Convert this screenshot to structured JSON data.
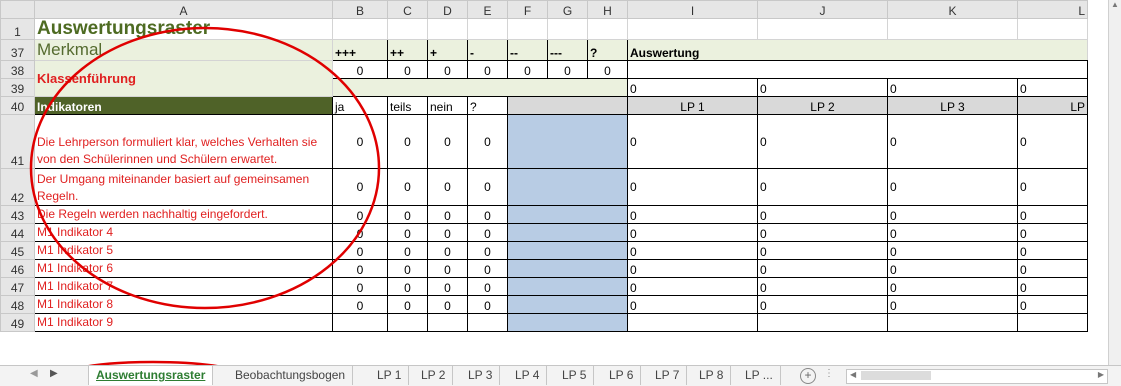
{
  "columns": [
    "A",
    "B",
    "C",
    "D",
    "E",
    "F",
    "G",
    "H",
    "I",
    "J",
    "K",
    "L"
  ],
  "rows": {
    "r1": {
      "num": "1",
      "title": "Auswertungsraster"
    },
    "r37": {
      "num": "37",
      "merkmal": "Merkmal",
      "symbols": [
        "+++",
        "++",
        "+",
        "-",
        "--",
        "---",
        "?"
      ],
      "auswertung": "Auswertung"
    },
    "r38": {
      "num": "38",
      "values": [
        "0",
        "0",
        "0",
        "0",
        "0",
        "0",
        "0"
      ]
    },
    "r38a": {
      "label": "Klassenführung"
    },
    "r39": {
      "num": "39",
      "lp_values": [
        "0",
        "0",
        "0",
        "0"
      ]
    },
    "r40": {
      "num": "40",
      "indikatoren": "Indikatoren",
      "headers": [
        "ja",
        "teils",
        "nein",
        "?"
      ],
      "lp": [
        "LP 1",
        "LP 2",
        "LP 3",
        "LP"
      ]
    },
    "r41": {
      "num": "41",
      "text": "Die Lehrperson formuliert klar, welches Verhalten sie von den Schülerinnen und Schülern erwartet.",
      "values": [
        "0",
        "0",
        "0",
        "0"
      ],
      "lp": [
        "0",
        "0",
        "0",
        "0"
      ]
    },
    "r42": {
      "num": "42",
      "text": "Der Umgang miteinander basiert auf gemeinsamen Regeln.",
      "values": [
        "0",
        "0",
        "0",
        "0"
      ],
      "lp": [
        "0",
        "0",
        "0",
        "0"
      ]
    },
    "r43": {
      "num": "43",
      "text": "Die Regeln werden nachhaltig eingefordert.",
      "values": [
        "0",
        "0",
        "0",
        "0"
      ],
      "lp": [
        "0",
        "0",
        "0",
        "0"
      ]
    },
    "r44": {
      "num": "44",
      "text": "M1 Indikator 4",
      "values": [
        "0",
        "0",
        "0",
        "0"
      ],
      "lp": [
        "0",
        "0",
        "0",
        "0"
      ]
    },
    "r45": {
      "num": "45",
      "text": "M1 Indikator 5",
      "values": [
        "0",
        "0",
        "0",
        "0"
      ],
      "lp": [
        "0",
        "0",
        "0",
        "0"
      ]
    },
    "r46": {
      "num": "46",
      "text": "M1 Indikator 6",
      "values": [
        "0",
        "0",
        "0",
        "0"
      ],
      "lp": [
        "0",
        "0",
        "0",
        "0"
      ]
    },
    "r47": {
      "num": "47",
      "text": "M1 Indikator 7",
      "values": [
        "0",
        "0",
        "0",
        "0"
      ],
      "lp": [
        "0",
        "0",
        "0",
        "0"
      ]
    },
    "r48": {
      "num": "48",
      "text": "M1 Indikator 8",
      "values": [
        "0",
        "0",
        "0",
        "0"
      ],
      "lp": [
        "0",
        "0",
        "0",
        "0"
      ]
    },
    "r49": {
      "num": "49",
      "text": "M1 Indikator 9"
    }
  },
  "tabs": [
    "Auswertungsraster",
    "Beobachtungsbogen",
    "LP 1",
    "LP 2",
    "LP 3",
    "LP 4",
    "LP 5",
    "LP 6",
    "LP 7",
    "LP 8",
    "LP ..."
  ],
  "active_tab": "Auswertungsraster",
  "colors": {
    "accent_green": "#4f6228",
    "light_green": "#ebf1de",
    "red_text": "#e02020",
    "blue_fill": "#b8cce4",
    "annotation": "#e00000"
  }
}
